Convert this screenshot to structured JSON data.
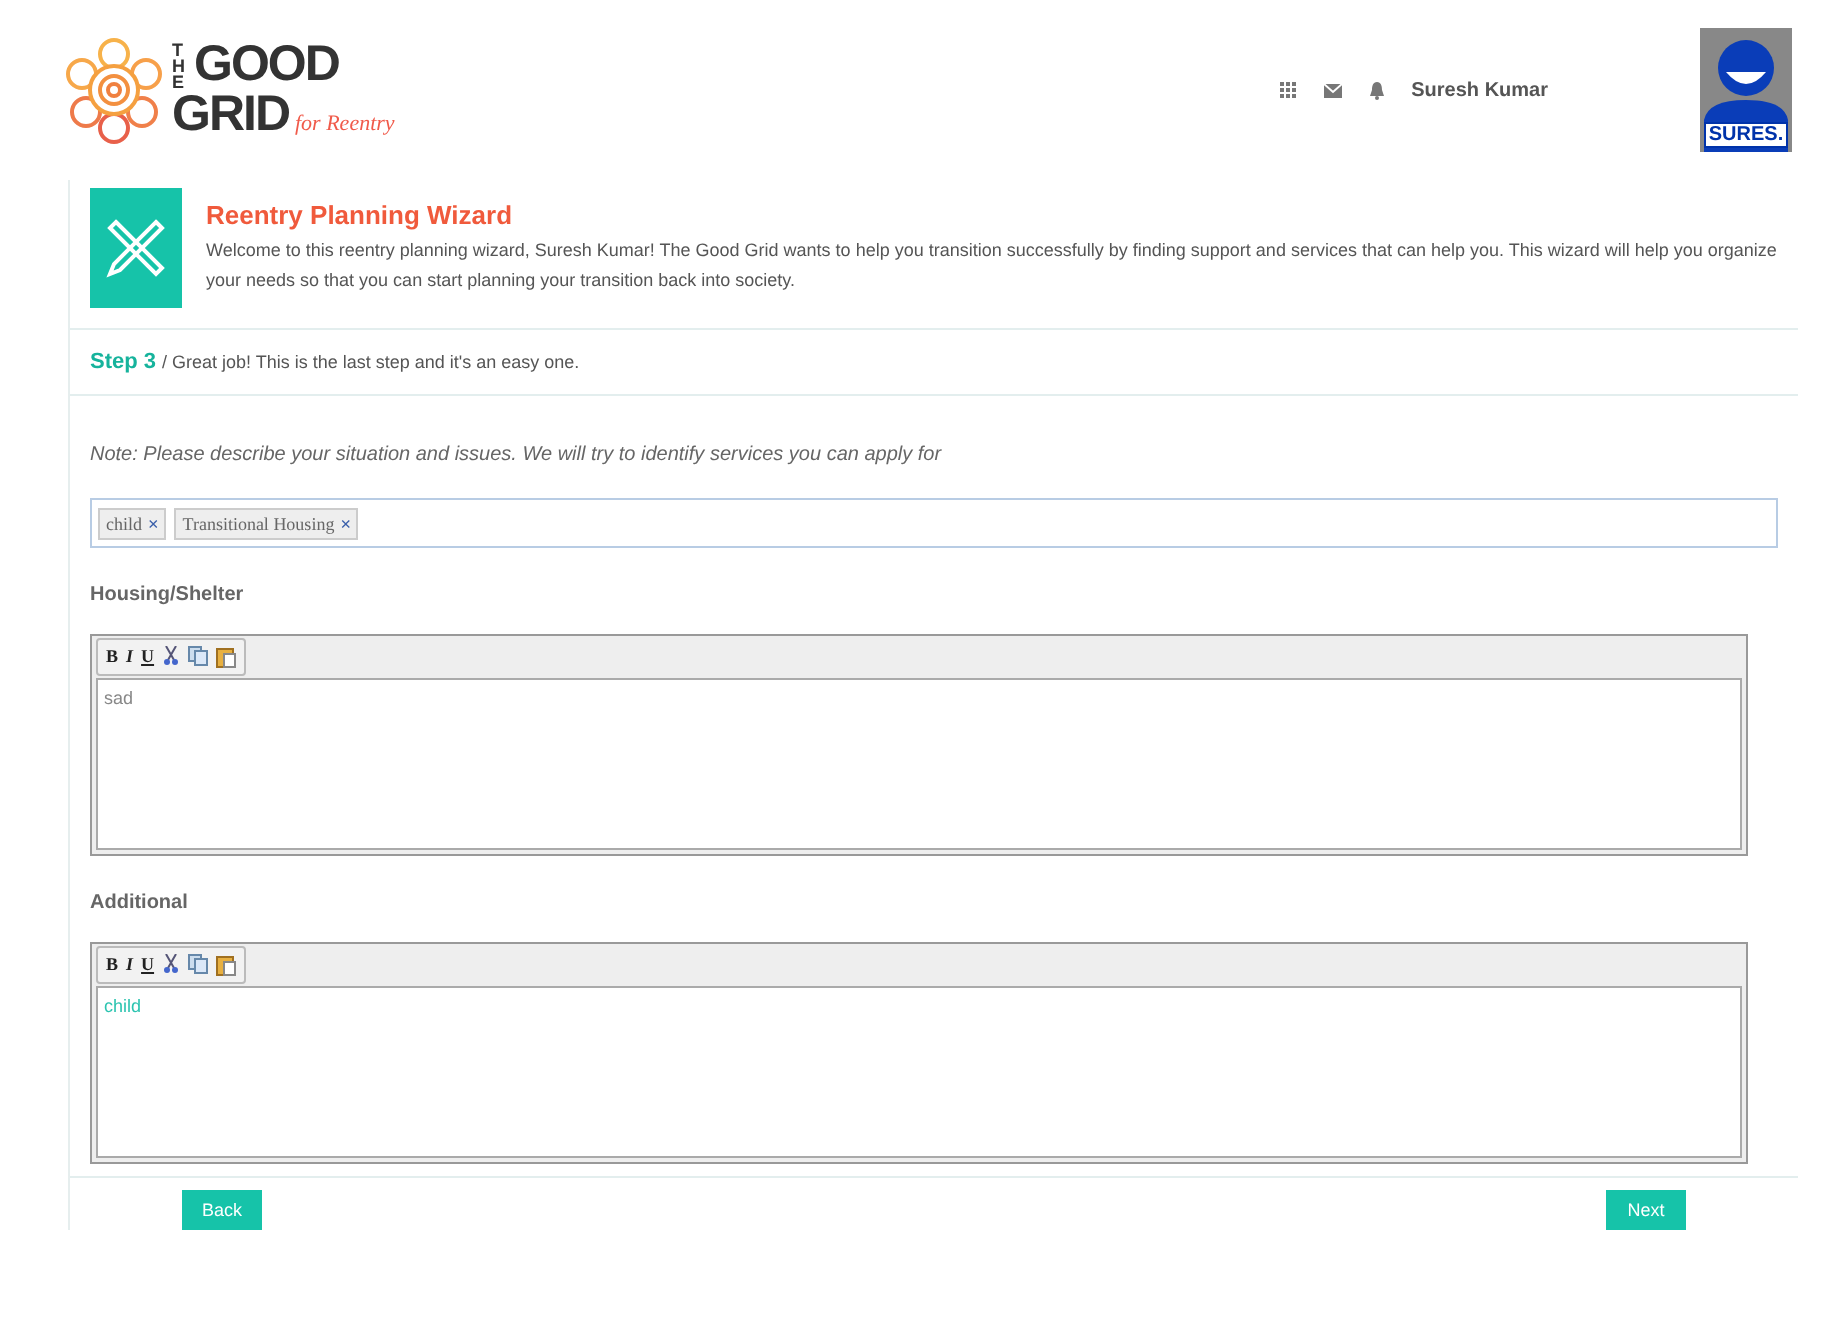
{
  "logo": {
    "line_1a": "THE",
    "line_1b": "GOOD",
    "line_2a": "GRID",
    "line_2b": "for Reentry"
  },
  "header": {
    "user_name": "Suresh Kumar",
    "avatar_label": "SURES."
  },
  "intro": {
    "title": "Reentry Planning Wizard",
    "text": "Welcome to this reentry planning wizard, Suresh Kumar! The Good Grid wants to help you transition successfully by finding support and services that can help you. This wizard will help you organize your needs so that you can start planning your transition back into society."
  },
  "step": {
    "label": "Step 3",
    "text": "/ Great job! This is the last step and it's an easy one."
  },
  "note": "Note: Please describe your situation and issues. We will try to identify services you can apply for",
  "tags": [
    {
      "label": "child",
      "remove": "×"
    },
    {
      "label": "Transitional Housing",
      "remove": "×"
    }
  ],
  "editors": [
    {
      "label": "Housing/Shelter",
      "toolbar": [
        "B",
        "I",
        "U"
      ],
      "value": "sad",
      "color": "#888888"
    },
    {
      "label": "Additional",
      "toolbar": [
        "B",
        "I",
        "U"
      ],
      "value": "child",
      "color": "#2cc4b0"
    }
  ],
  "buttons": {
    "back": "Back",
    "next": "Next"
  }
}
